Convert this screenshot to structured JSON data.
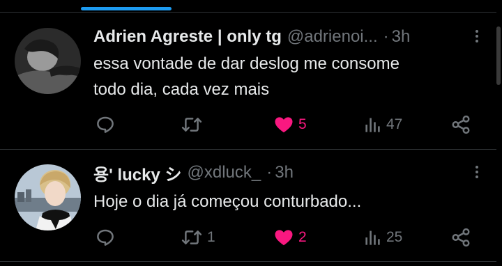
{
  "colors": {
    "accent": "#1d9bf0",
    "like": "#f91880",
    "muted": "#71767b",
    "text": "#e7e9ea",
    "divider": "#2f3336"
  },
  "tweets": [
    {
      "name": "Adrien Agreste | only tg",
      "handle": "@adrienoi...",
      "separator": "·",
      "time": "3h",
      "text_lines": [
        "essa vontade de dar deslog me consome",
        "todo dia, cada vez mais"
      ],
      "replies": "",
      "retweets": "",
      "likes": "5",
      "liked": true,
      "views": "47",
      "icons": [
        "reply-icon",
        "retweet-icon",
        "heart-filled-icon",
        "views-icon",
        "share-icon",
        "more-icon"
      ]
    },
    {
      "name": "용' lucky シ",
      "handle": "@xdluck_",
      "separator": "·",
      "time": "3h",
      "text_lines": [
        "Hoje o dia já começou conturbado..."
      ],
      "replies": "",
      "retweets": "1",
      "likes": "2",
      "liked": true,
      "views": "25",
      "icons": [
        "reply-icon",
        "retweet-icon",
        "heart-filled-icon",
        "views-icon",
        "share-icon",
        "more-icon"
      ]
    }
  ]
}
